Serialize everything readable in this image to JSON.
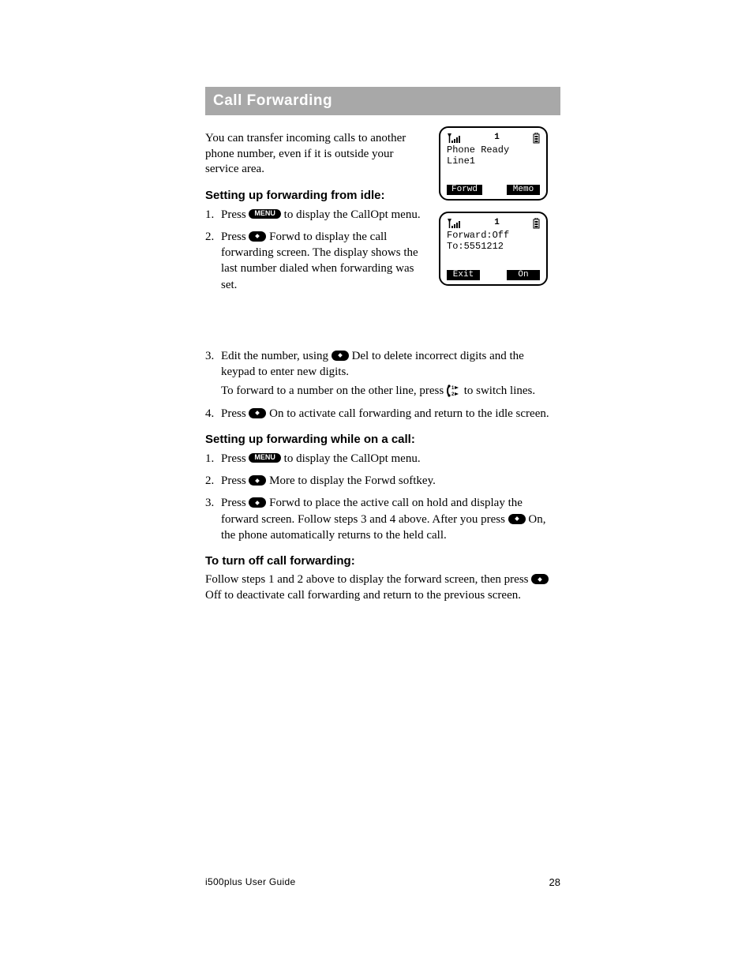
{
  "header": {
    "title": "Call Forwarding"
  },
  "intro": "You can transfer incoming calls to another phone number, even if it is outside your service area.",
  "section1": {
    "heading": "Setting up forwarding from idle:",
    "steps": [
      {
        "n": "1.",
        "pre": "Press ",
        "btn": "MENU",
        "post": " to display the CallOpt menu."
      },
      {
        "n": "2.",
        "pre": "Press ",
        "btn": "dot",
        "post": " Forwd to display the call forwarding screen. The display shows the last number dialed when forwarding was set."
      },
      {
        "n": "3.",
        "pre": "",
        "post": "Edit the number, using ",
        "btn": "dot",
        "post2": " Del to delete incorrect digits and the keypad to enter new digits.",
        "sub": "To forward to a number on the other line, press ",
        "lineicon": true,
        "sub2": " to switch lines."
      },
      {
        "n": "4.",
        "pre": "Press ",
        "btn": "dot",
        "post": " On to activate call forwarding and return to the idle screen."
      }
    ]
  },
  "section2": {
    "heading": "Setting up forwarding while on a call:",
    "steps": [
      {
        "n": "1.",
        "pre": "Press ",
        "btn": "MENU",
        "post": " to display the CallOpt menu."
      },
      {
        "n": "2.",
        "pre": "Press ",
        "btn": "dot",
        "post": " More to display the Forwd softkey."
      },
      {
        "n": "3.",
        "pre": "Press ",
        "btn": "dot",
        "post": " Forwd to place the active call on hold and display the forward screen. Follow steps 3 and 4 above. After you press ",
        "btn2": "dot",
        "post2": " On, the phone automatically returns to the held call."
      }
    ]
  },
  "turnoff": {
    "heading": "To turn off call forwarding:",
    "body_pre": "Follow steps 1 and 2 above to display the forward screen, then press ",
    "btn": "dot",
    "body_post": " Off to deactivate call forwarding and return to the previous screen."
  },
  "lcd1": {
    "chnum": "1",
    "line1": "Phone Ready",
    "line2": "Line1",
    "sk_left": "Forwd",
    "sk_right": "Memo"
  },
  "lcd2": {
    "chnum": "1",
    "line1": "Forward:Off",
    "line2": "To:5551212",
    "sk_left": "Exit",
    "sk_right": "On"
  },
  "footer": {
    "page_num": "28",
    "running_head": "i500plus User Guide"
  }
}
